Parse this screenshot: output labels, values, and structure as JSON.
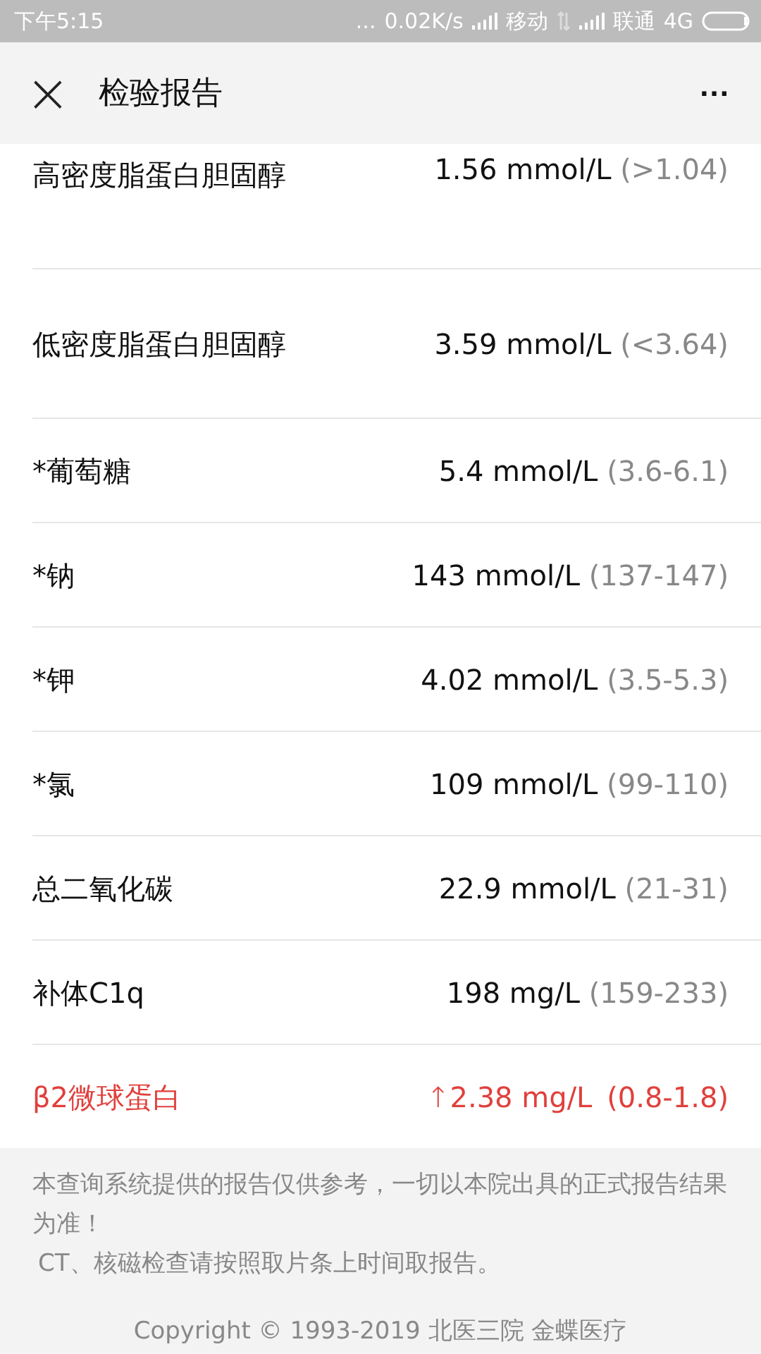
{
  "status_bar": {
    "time": "下午5:15",
    "dots": "...",
    "speed": "0.02K/s",
    "carrier_1": "移动",
    "carrier_2": "联通",
    "network": "4G"
  },
  "header": {
    "close": "×",
    "title": "检验报告",
    "more": "..."
  },
  "results": [
    {
      "name": "高密度脂蛋白胆固醇",
      "value": "1.56 mmol/L",
      "range": "(>1.04)",
      "abnormal": false
    },
    {
      "name": "低密度脂蛋白胆固醇",
      "value": "3.59 mmol/L",
      "range": "(<3.64)",
      "abnormal": false
    },
    {
      "name": "*葡萄糖",
      "value": "5.4 mmol/L",
      "range": "(3.6-6.1)",
      "abnormal": false
    },
    {
      "name": "*钠",
      "value": "143 mmol/L",
      "range": "(137-147)",
      "abnormal": false
    },
    {
      "name": "*钾",
      "value": "4.02 mmol/L",
      "range": "(3.5-5.3)",
      "abnormal": false
    },
    {
      "name": "*氯",
      "value": "109 mmol/L",
      "range": "(99-110)",
      "abnormal": false
    },
    {
      "name": "总二氧化碳",
      "value": "22.9 mmol/L",
      "range": "(21-31)",
      "abnormal": false
    },
    {
      "name": "补体C1q",
      "value": "198 mg/L",
      "range": "(159-233)",
      "abnormal": false
    },
    {
      "name": "β2微球蛋白",
      "value": "2.38 mg/L",
      "range": "(0.8-1.8)",
      "abnormal": true,
      "arrow": "↑"
    }
  ],
  "footer": {
    "notice": [
      "本查询系统提供的报告仅供参考，一切以本院出具的正式报告结果为准！",
      "CT、核磁检查请按照取片条上时间取报告。"
    ],
    "copyright": "Copyright © 1993-2019 北医三院 金蝶医疗"
  }
}
